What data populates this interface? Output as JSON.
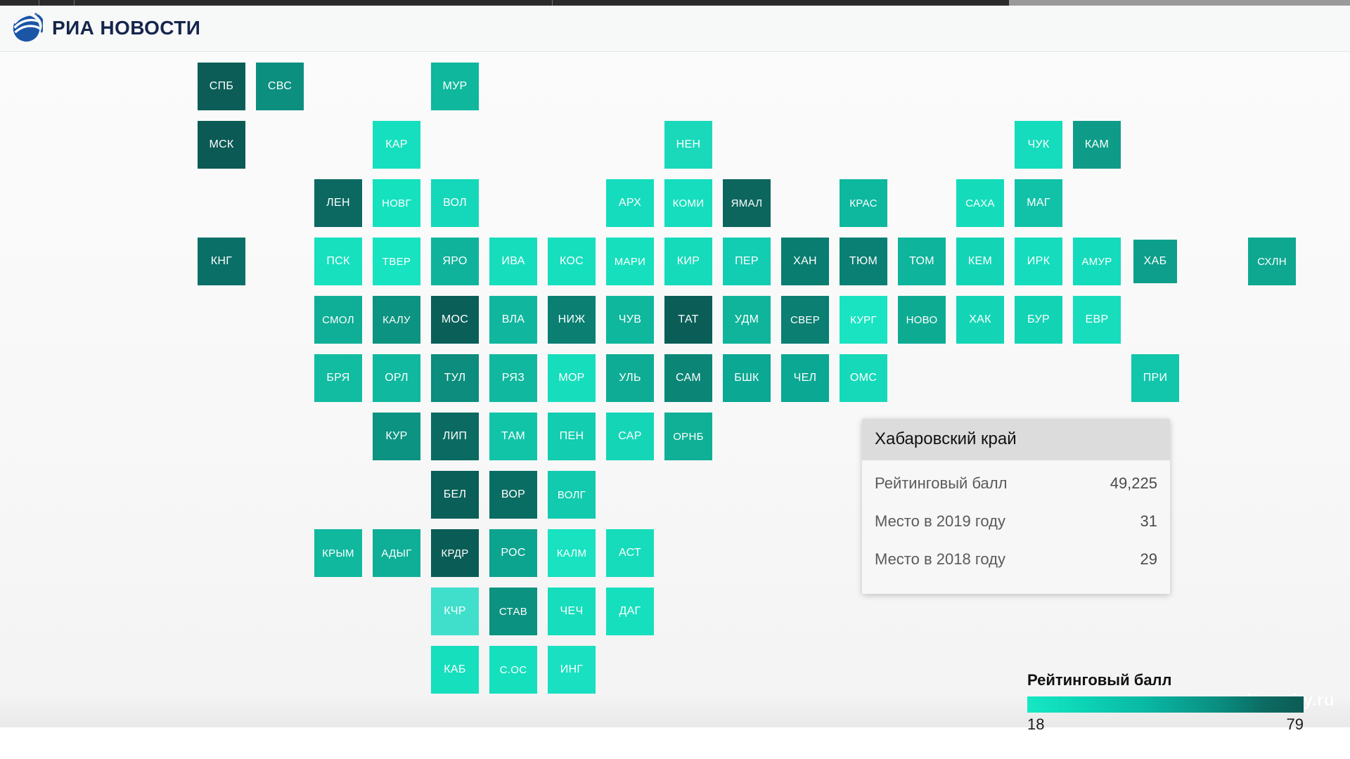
{
  "browser": {
    "chrome_color": "#2b2b2b"
  },
  "header": {
    "site_name": "РИА НОВОСТИ",
    "logo_icon": "ria-globe-logo",
    "brand_color": "#16254c"
  },
  "watermark": {
    "text": "komcity.ru"
  },
  "tooltip": {
    "region_title": "Хабаровский край",
    "rows": [
      {
        "label": "Рейтинговый балл",
        "value": "49,225"
      },
      {
        "label": "Место в 2019 году",
        "value": "31"
      },
      {
        "label": "Место в 2018 году",
        "value": "29"
      }
    ]
  },
  "legend": {
    "title": "Рейтинговый балл",
    "min": "18",
    "max": "79",
    "gradient_start": "#16e8c3",
    "gradient_end": "#0d5a54"
  },
  "chart_data": {
    "type": "heatmap",
    "title": "Рейтинговый балл",
    "xlabel": "",
    "ylabel": "",
    "grid": false,
    "legend_position": "bottom-right",
    "value_label": "Рейтинговый балл",
    "value_range": [
      18,
      79
    ],
    "colorscale": [
      "#16e8c3",
      "#0d5a54"
    ],
    "cell_size": 68,
    "cell_pitch": 83,
    "hovered_cell": "ХАБ",
    "cells": [
      {
        "code": "СПБ",
        "col": 0,
        "row": 0,
        "color": "#0c5d57"
      },
      {
        "code": "СВС",
        "col": 1,
        "row": 0,
        "color": "#0d8f7f"
      },
      {
        "code": "МУР",
        "col": 4,
        "row": 0,
        "color": "#0fb79c"
      },
      {
        "code": "МСК",
        "col": 0,
        "row": 1,
        "color": "#0c5a55"
      },
      {
        "code": "КАР",
        "col": 3,
        "row": 1,
        "color": "#15dfbe"
      },
      {
        "code": "НЕН",
        "col": 8,
        "row": 1,
        "color": "#1ad9bb"
      },
      {
        "code": "ЧУК",
        "col": 14,
        "row": 1,
        "color": "#14dcbc"
      },
      {
        "code": "КАМ",
        "col": 15,
        "row": 1,
        "color": "#0e9c88"
      },
      {
        "code": "ЛЕН",
        "col": 2,
        "row": 2,
        "color": "#0b6961"
      },
      {
        "code": "НОВГ",
        "col": 3,
        "row": 2,
        "color": "#16e1bf"
      },
      {
        "code": "ВОЛ",
        "col": 4,
        "row": 2,
        "color": "#15d8ba"
      },
      {
        "code": "АРХ",
        "col": 7,
        "row": 2,
        "color": "#15dcbd"
      },
      {
        "code": "КОМИ",
        "col": 8,
        "row": 2,
        "color": "#16ddbd"
      },
      {
        "code": "ЯМАЛ",
        "col": 9,
        "row": 2,
        "color": "#0c665e"
      },
      {
        "code": "КРАС",
        "col": 11,
        "row": 2,
        "color": "#0db89e"
      },
      {
        "code": "САХА",
        "col": 13,
        "row": 2,
        "color": "#14dcbb"
      },
      {
        "code": "МАГ",
        "col": 14,
        "row": 2,
        "color": "#12c2a8"
      },
      {
        "code": "КНГ",
        "col": 0,
        "row": 3,
        "color": "#0a6f66"
      },
      {
        "code": "ПСК",
        "col": 2,
        "row": 3,
        "color": "#16e0be"
      },
      {
        "code": "ТВЕР",
        "col": 3,
        "row": 3,
        "color": "#17e3c0"
      },
      {
        "code": "ЯРО",
        "col": 4,
        "row": 3,
        "color": "#0fb39b"
      },
      {
        "code": "ИВА",
        "col": 5,
        "row": 3,
        "color": "#16ddbc"
      },
      {
        "code": "КОС",
        "col": 6,
        "row": 3,
        "color": "#16dfbd"
      },
      {
        "code": "МАРИ",
        "col": 7,
        "row": 3,
        "color": "#16dfbd"
      },
      {
        "code": "КИР",
        "col": 8,
        "row": 3,
        "color": "#15dbba"
      },
      {
        "code": "ПЕР",
        "col": 9,
        "row": 3,
        "color": "#13cdb2"
      },
      {
        "code": "ХАН",
        "col": 10,
        "row": 3,
        "color": "#0a7d71"
      },
      {
        "code": "ТЮМ",
        "col": 11,
        "row": 3,
        "color": "#0a7f73"
      },
      {
        "code": "ТОМ",
        "col": 12,
        "row": 3,
        "color": "#0eb49b"
      },
      {
        "code": "КЕМ",
        "col": 13,
        "row": 3,
        "color": "#14d4b6"
      },
      {
        "code": "ИРК",
        "col": 14,
        "row": 3,
        "color": "#15dcbc"
      },
      {
        "code": "АМУР",
        "col": 15,
        "row": 3,
        "color": "#14dbbb"
      },
      {
        "code": "ХАБ",
        "col": 16,
        "row": 3,
        "color": "#0d9f8b"
      },
      {
        "code": "СХЛН",
        "col": 18,
        "row": 3,
        "color": "#0ea890"
      },
      {
        "code": "СМОЛ",
        "col": 2,
        "row": 4,
        "color": "#0fae97"
      },
      {
        "code": "КАЛУ",
        "col": 3,
        "row": 4,
        "color": "#0c9381"
      },
      {
        "code": "МОС",
        "col": 4,
        "row": 4,
        "color": "#0a5f59"
      },
      {
        "code": "ВЛА",
        "col": 5,
        "row": 4,
        "color": "#10b69d"
      },
      {
        "code": "НИЖ",
        "col": 6,
        "row": 4,
        "color": "#0a7f72"
      },
      {
        "code": "ЧУВ",
        "col": 7,
        "row": 4,
        "color": "#0fb79d"
      },
      {
        "code": "ТАТ",
        "col": 8,
        "row": 4,
        "color": "#0a5e57"
      },
      {
        "code": "УДМ",
        "col": 9,
        "row": 4,
        "color": "#0fb49a"
      },
      {
        "code": "СВЕР",
        "col": 10,
        "row": 4,
        "color": "#0a7f72"
      },
      {
        "code": "КУРГ",
        "col": 11,
        "row": 4,
        "color": "#1ae3c2"
      },
      {
        "code": "НОВО",
        "col": 12,
        "row": 4,
        "color": "#0eab93"
      },
      {
        "code": "ХАК",
        "col": 13,
        "row": 4,
        "color": "#13d5b6"
      },
      {
        "code": "БУР",
        "col": 14,
        "row": 4,
        "color": "#12d4b5"
      },
      {
        "code": "ЕВР",
        "col": 15,
        "row": 4,
        "color": "#17ddbd"
      },
      {
        "code": "БРЯ",
        "col": 2,
        "row": 5,
        "color": "#11bca1"
      },
      {
        "code": "ОРЛ",
        "col": 3,
        "row": 5,
        "color": "#0fb89e"
      },
      {
        "code": "ТУЛ",
        "col": 4,
        "row": 5,
        "color": "#0c8d7d"
      },
      {
        "code": "РЯЗ",
        "col": 5,
        "row": 5,
        "color": "#0fb89e"
      },
      {
        "code": "МОР",
        "col": 6,
        "row": 5,
        "color": "#16ddbc"
      },
      {
        "code": "УЛЬ",
        "col": 7,
        "row": 5,
        "color": "#0eac94"
      },
      {
        "code": "САМ",
        "col": 8,
        "row": 5,
        "color": "#0b8576"
      },
      {
        "code": "БШК",
        "col": 9,
        "row": 5,
        "color": "#0ba893"
      },
      {
        "code": "ЧЕЛ",
        "col": 10,
        "row": 5,
        "color": "#0ba893"
      },
      {
        "code": "ОМС",
        "col": 11,
        "row": 5,
        "color": "#15d9b9"
      },
      {
        "code": "ПРИ",
        "col": 16,
        "row": 5,
        "color": "#12c6ab"
      },
      {
        "code": "КУР",
        "col": 3,
        "row": 6,
        "color": "#0c9382"
      },
      {
        "code": "ЛИП",
        "col": 4,
        "row": 6,
        "color": "#0b6b62"
      },
      {
        "code": "ТАМ",
        "col": 5,
        "row": 6,
        "color": "#11c4a8"
      },
      {
        "code": "ПЕН",
        "col": 6,
        "row": 6,
        "color": "#12cdb0"
      },
      {
        "code": "САР",
        "col": 7,
        "row": 6,
        "color": "#14d6b7"
      },
      {
        "code": "ОРНБ",
        "col": 8,
        "row": 6,
        "color": "#0fb096"
      },
      {
        "code": "БЕЛ",
        "col": 4,
        "row": 7,
        "color": "#0a5f58"
      },
      {
        "code": "ВОР",
        "col": 5,
        "row": 7,
        "color": "#0a6d63"
      },
      {
        "code": "ВОЛГ",
        "col": 6,
        "row": 7,
        "color": "#12cbaf"
      },
      {
        "code": "КРЫМ",
        "col": 2,
        "row": 8,
        "color": "#10b89e"
      },
      {
        "code": "АДЫГ",
        "col": 3,
        "row": 8,
        "color": "#0fae97"
      },
      {
        "code": "КРДР",
        "col": 4,
        "row": 8,
        "color": "#0a5d56"
      },
      {
        "code": "РОС",
        "col": 5,
        "row": 8,
        "color": "#0ca38f"
      },
      {
        "code": "КАЛМ",
        "col": 6,
        "row": 8,
        "color": "#18e2c0"
      },
      {
        "code": "АСТ",
        "col": 7,
        "row": 8,
        "color": "#16dcbb"
      },
      {
        "code": "КЧР",
        "col": 4,
        "row": 9,
        "color": "#3fdfcb"
      },
      {
        "code": "СТАВ",
        "col": 5,
        "row": 9,
        "color": "#0b9281"
      },
      {
        "code": "ЧЕЧ",
        "col": 6,
        "row": 9,
        "color": "#16ddbc"
      },
      {
        "code": "ДАГ",
        "col": 7,
        "row": 9,
        "color": "#16dfbd"
      },
      {
        "code": "КАБ",
        "col": 4,
        "row": 10,
        "color": "#16dfbe"
      },
      {
        "code": "С.ОС",
        "col": 5,
        "row": 10,
        "color": "#16dfbe"
      },
      {
        "code": "ИНГ",
        "col": 6,
        "row": 10,
        "color": "#18e0c0"
      }
    ]
  }
}
